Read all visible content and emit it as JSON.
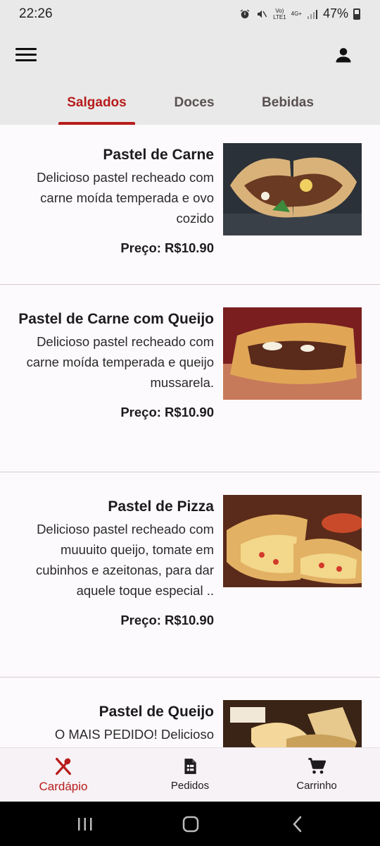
{
  "status": {
    "time": "22:26",
    "network_top": "Vo)",
    "network_bottom": "LTE1",
    "net_type": "4G+",
    "battery": "47%"
  },
  "tabs": [
    {
      "label": "Salgados",
      "active": true
    },
    {
      "label": "Doces",
      "active": false
    },
    {
      "label": "Bebidas",
      "active": false
    }
  ],
  "items": [
    {
      "title": "Pastel de Carne",
      "description": "Delicioso pastel recheado com carne moída temperada e ovo cozido",
      "price": "Preço: R$10.90"
    },
    {
      "title": "Pastel de Carne com Queijo",
      "description": "Delicioso pastel recheado com carne moída temperada e queijo mussarela.",
      "price": "Preço: R$10.90"
    },
    {
      "title": "Pastel de Pizza",
      "description": "Delicioso pastel recheado com muuuito queijo, tomate em cubinhos e azeitonas, para dar aquele toque especial ..",
      "price": "Preço: R$10.90"
    },
    {
      "title": "Pastel de Queijo",
      "description": "O MAIS PEDIDO! Delicioso",
      "price": ""
    }
  ],
  "bottom_nav": [
    {
      "label": "Cardápio",
      "icon": "restaurant-icon",
      "active": true
    },
    {
      "label": "Pedidos",
      "icon": "receipt-icon",
      "active": false
    },
    {
      "label": "Carrinho",
      "icon": "cart-icon",
      "active": false
    }
  ],
  "colors": {
    "accent": "#b71c1c",
    "background": "#fdfafd",
    "appbar": "#e9e9e9"
  }
}
